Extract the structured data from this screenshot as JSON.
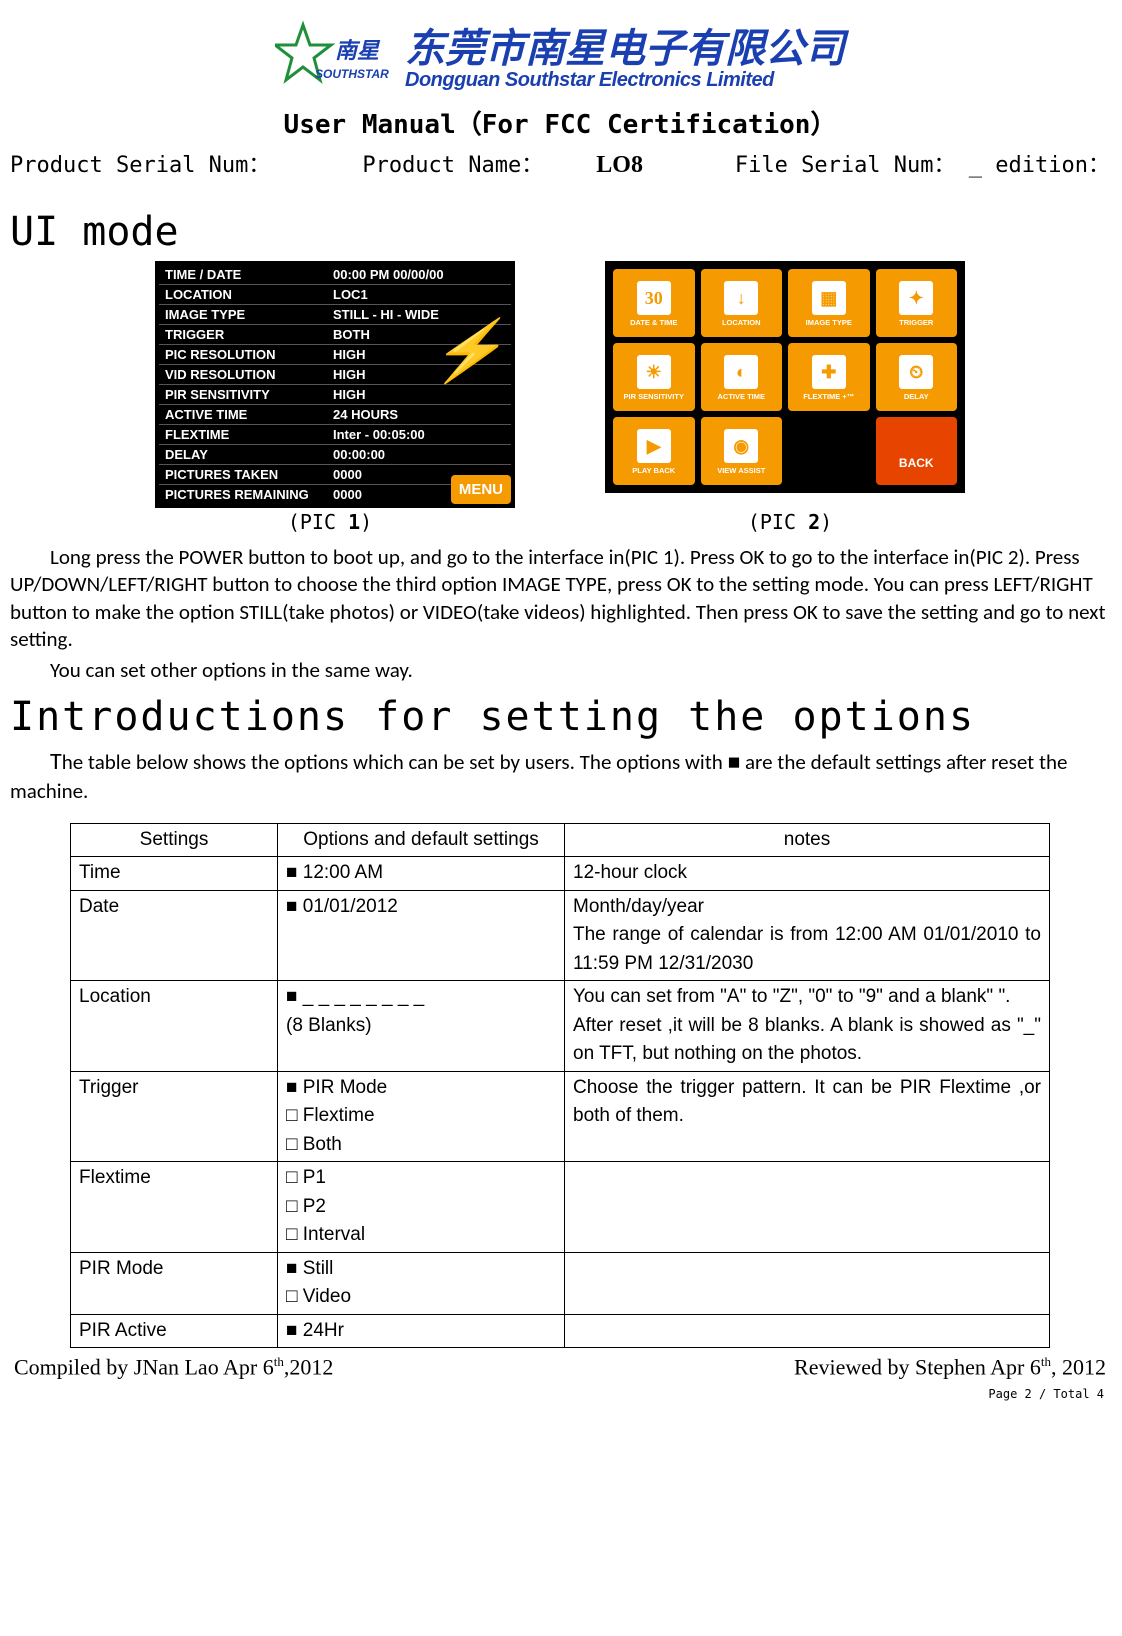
{
  "header": {
    "company_cn": "东莞市南星电子有限公司",
    "company_en": "Dongguan Southstar Electronics Limited",
    "doc_title": "User Manual（For FCC Certification）",
    "serial_label": "Product Serial Num：",
    "name_label": "Product Name：",
    "name_value": "LO8",
    "file_label": "File Serial Num： _ edition："
  },
  "sections": {
    "ui_mode": "UI mode",
    "intro": "Introductions for setting the options"
  },
  "pic1": {
    "caption_prefix": "(PIC ",
    "caption_num": "1",
    "caption_suffix": ")",
    "rows": [
      {
        "label": "TIME / DATE",
        "value": "00:00 PM  00/00/00"
      },
      {
        "label": "LOCATION",
        "value": "LOC1"
      },
      {
        "label": "IMAGE TYPE",
        "value": "STILL - HI - WIDE"
      },
      {
        "label": "TRIGGER",
        "value": "BOTH"
      },
      {
        "label": "PIC RESOLUTION",
        "value": "HIGH"
      },
      {
        "label": "VID RESOLUTION",
        "value": "HIGH"
      },
      {
        "label": "PIR SENSITIVITY",
        "value": "HIGH"
      },
      {
        "label": "ACTIVE TIME",
        "value": "24 HOURS"
      },
      {
        "label": "FLEXTIME",
        "value": "Inter - 00:05:00"
      },
      {
        "label": "DELAY",
        "value": "00:00:00"
      },
      {
        "label": "PICTURES TAKEN",
        "value": "0000"
      },
      {
        "label": "PICTURES REMAINING",
        "value": "0000"
      }
    ],
    "menu_btn": "MENU"
  },
  "pic2": {
    "caption_prefix": "(PIC ",
    "caption_num": "2",
    "caption_suffix": ")",
    "cells": [
      {
        "label": "DATE & TIME",
        "glyph": "30"
      },
      {
        "label": "LOCATION",
        "glyph": "↓"
      },
      {
        "label": "IMAGE TYPE",
        "glyph": "▦"
      },
      {
        "label": "TRIGGER",
        "glyph": "✦"
      },
      {
        "label": "PIR SENSITIVITY",
        "glyph": "☀"
      },
      {
        "label": "ACTIVE TIME",
        "glyph": "◐"
      },
      {
        "label": "FLEXTIME +™",
        "glyph": "✚"
      },
      {
        "label": "DELAY",
        "glyph": "⏲"
      },
      {
        "label": "PLAY BACK",
        "glyph": "▶"
      },
      {
        "label": "VIEW ASSIST",
        "glyph": "◉"
      }
    ],
    "back_label": "BACK"
  },
  "body": {
    "p1": "Long press the POWER button to boot up, and go to the interface in(PIC 1). Press OK to go to the interface in(PIC 2). Press UP/DOWN/LEFT/RIGHT button to choose the third option IMAGE TYPE, press OK to the setting mode. You can press LEFT/RIGHT button to make the option STILL(take photos) or VIDEO(take videos) highlighted. Then press OK to save the setting and go to next setting.",
    "p2": "You can set other options in the same way.",
    "intro_first": "T",
    "intro_rest": "he table below shows the options which can be set by users. The options with ■ are the default settings after reset the machine."
  },
  "table": {
    "headers": [
      "Settings",
      "Options and default settings",
      "notes"
    ],
    "rows": [
      {
        "s": "Time",
        "o": "■ 12:00 AM",
        "n": "12-hour clock"
      },
      {
        "s": "Date",
        "o": "■ 01/01/2012",
        "n": "Month/day/year\nThe range of calendar is from 12:00 AM 01/01/2010   to   11:59 PM 12/31/2030"
      },
      {
        "s": "Location",
        "o": "■ _ _ _ _ _ _ _ _\n (8  Blanks)",
        "n": "You can set from \"A\" to \"Z\", \"0\" to \"9\" and a blank\" \".\nAfter reset ,it will be 8 blanks. A blank is showed as \"_\" on TFT, but nothing on the photos."
      },
      {
        "s": "Trigger",
        "o": "■ PIR Mode\n□ Flextime\n□ Both",
        "n": "Choose the trigger pattern. It can be PIR Flextime ,or both of them."
      },
      {
        "s": "Flextime",
        "o": "□ P1\n□ P2\n□ Interval",
        "n": ""
      },
      {
        "s": "PIR Mode",
        "o": "■ Still\n□ Video",
        "n": ""
      },
      {
        "s": "PIR Active",
        "o": "■ 24Hr",
        "n": ""
      }
    ]
  },
  "footer": {
    "compiled": "Compiled by JNan Lao    Apr 6",
    "compiled_sup": "th",
    "compiled_year": ",2012",
    "reviewed": "Reviewed by Stephen    Apr 6",
    "reviewed_sup": "th",
    "reviewed_year": ", 2012",
    "page": "Page 2 / Total 4"
  }
}
